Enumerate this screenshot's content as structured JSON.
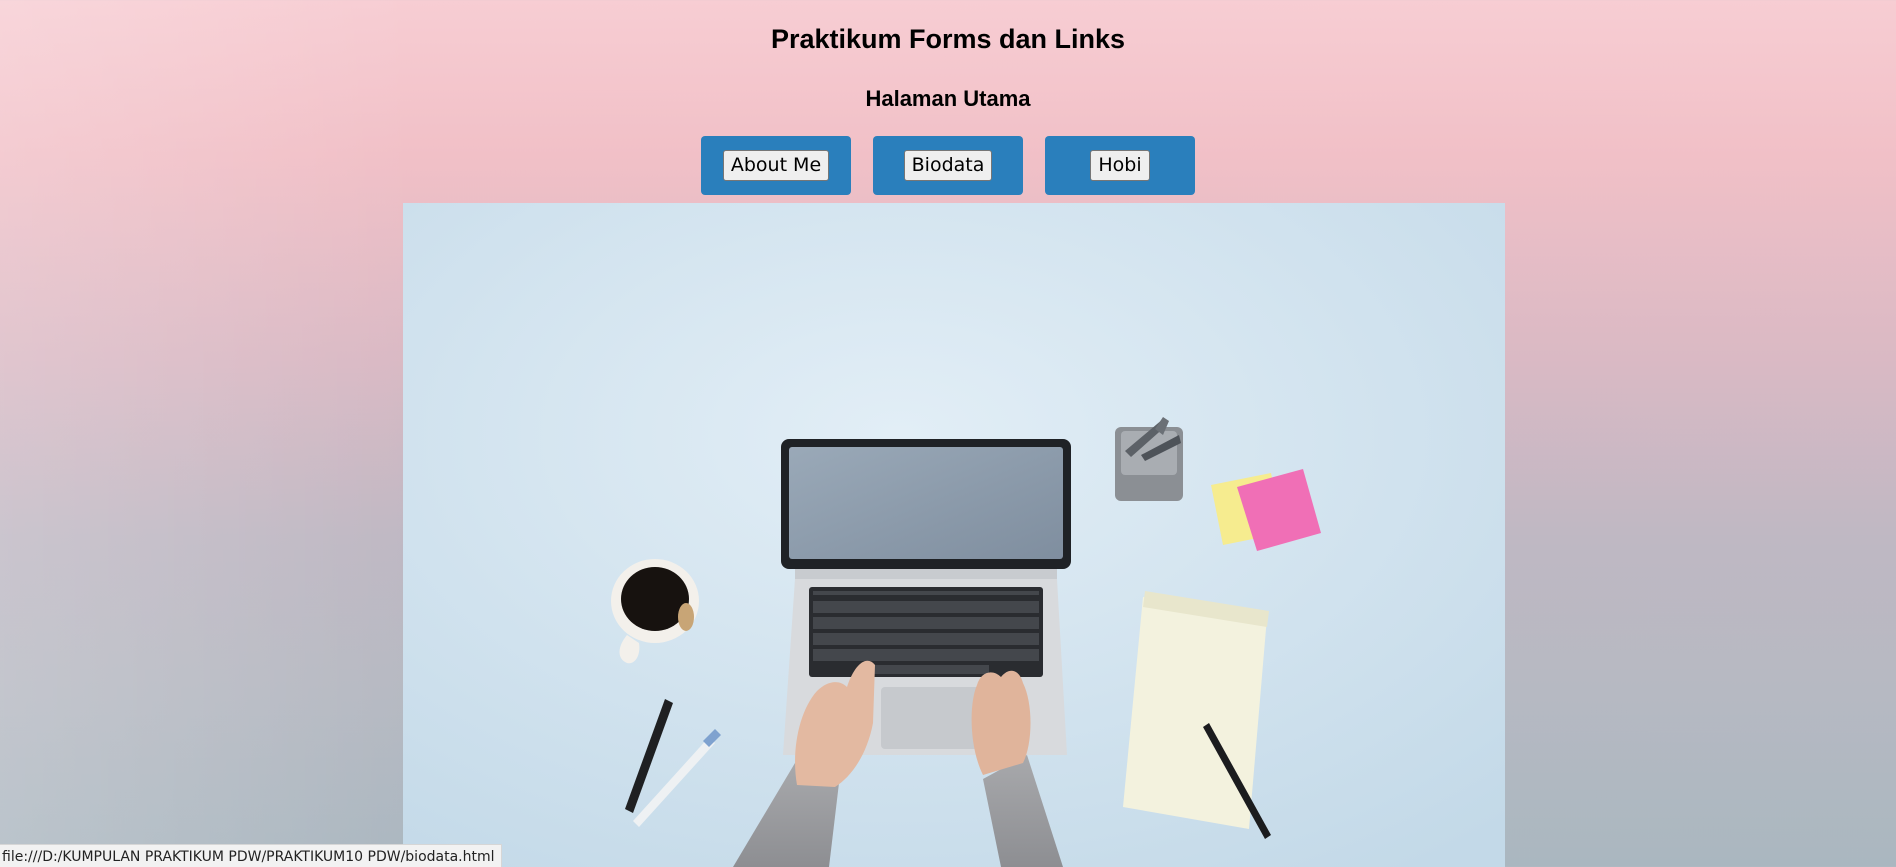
{
  "page": {
    "title": "Praktikum Forms dan Links",
    "subtitle": "Halaman Utama"
  },
  "nav": {
    "about_label": "About Me",
    "biodata_label": "Biodata",
    "hobi_label": "Hobi"
  },
  "hero": {
    "alt": "Workspace with laptop, coffee cup, notepad and sticky notes"
  },
  "status_bar": {
    "url": "file:///D:/KUMPULAN PRAKTIKUM PDW/PRAKTIKUM10 PDW/biodata.html"
  },
  "colors": {
    "nav_box": "#2a7fbc",
    "hero_bg": "#d4e6f1"
  }
}
